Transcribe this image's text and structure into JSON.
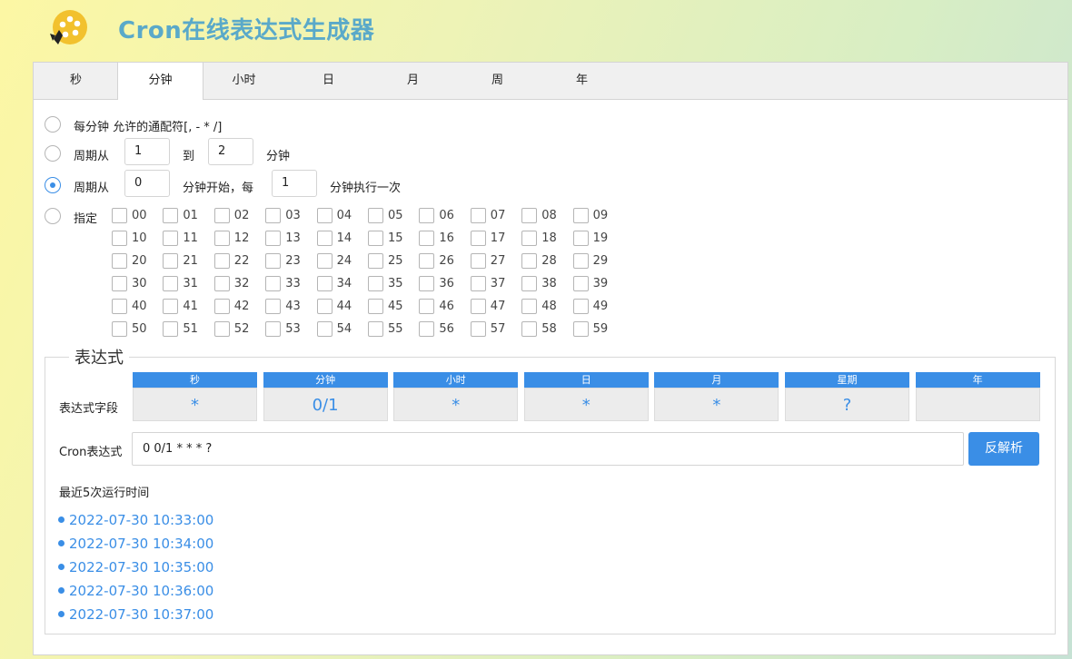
{
  "app": {
    "title": "Cron在线表达式生成器",
    "logo_icon": "film-reel-logo"
  },
  "tabs": [
    {
      "label": "秒"
    },
    {
      "label": "分钟"
    },
    {
      "label": "小时"
    },
    {
      "label": "日"
    },
    {
      "label": "月"
    },
    {
      "label": "周"
    },
    {
      "label": "年"
    }
  ],
  "active_tab": "分钟",
  "options": {
    "every": {
      "label": "每分钟 允许的通配符[, - * /]"
    },
    "range": {
      "label": "周期从",
      "from": "1",
      "to_label": "到",
      "to": "2",
      "unit": "分钟"
    },
    "increment": {
      "label": "周期从",
      "start": "0",
      "mid_label": "分钟开始，每",
      "step": "1",
      "unit": "分钟执行一次"
    },
    "specific": {
      "label": "指定"
    },
    "selected": "increment"
  },
  "minutes": [
    "00",
    "01",
    "02",
    "03",
    "04",
    "05",
    "06",
    "07",
    "08",
    "09",
    "10",
    "11",
    "12",
    "13",
    "14",
    "15",
    "16",
    "17",
    "18",
    "19",
    "20",
    "21",
    "22",
    "23",
    "24",
    "25",
    "26",
    "27",
    "28",
    "29",
    "30",
    "31",
    "32",
    "33",
    "34",
    "35",
    "36",
    "37",
    "38",
    "39",
    "40",
    "41",
    "42",
    "43",
    "44",
    "45",
    "46",
    "47",
    "48",
    "49",
    "50",
    "51",
    "52",
    "53",
    "54",
    "55",
    "56",
    "57",
    "58",
    "59"
  ],
  "expression": {
    "legend": "表达式",
    "fields_label": "表达式字段",
    "fields": [
      {
        "name": "秒",
        "value": "*"
      },
      {
        "name": "分钟",
        "value": "0/1"
      },
      {
        "name": "小时",
        "value": "*"
      },
      {
        "name": "日",
        "value": "*"
      },
      {
        "name": "月",
        "value": "*"
      },
      {
        "name": "星期",
        "value": "?"
      },
      {
        "name": "年",
        "value": ""
      }
    ],
    "cron_label": "Cron表达式",
    "cron_value": "0 0/1 * * * ?",
    "parse_button": "反解析",
    "recent_label": "最近5次运行时间",
    "recent_runs": [
      "2022-07-30 10:33:00",
      "2022-07-30 10:34:00",
      "2022-07-30 10:35:00",
      "2022-07-30 10:36:00",
      "2022-07-30 10:37:00"
    ]
  },
  "colors": {
    "accent": "#3a8ee6",
    "title": "#5aa9c9"
  }
}
